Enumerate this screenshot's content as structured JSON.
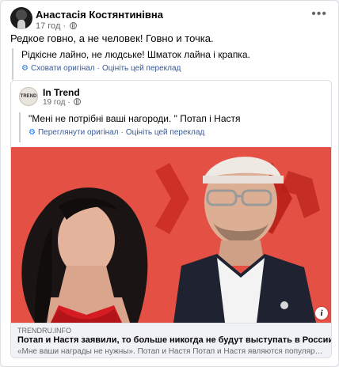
{
  "post": {
    "author": "Анастасія Костянтинівна",
    "time": "17 год",
    "more_icon": "•••",
    "text": "Редкое говно, а не человек! Говно и точка.",
    "translation": {
      "text": "Рідкісне лайно, не людське! Шматок лайна і крапка.",
      "hide_original": "Сховати оригінал",
      "rate": "Оцініть цей переклад"
    }
  },
  "shared": {
    "avatar_text": "TREND",
    "author": "In Trend",
    "time": "19 год",
    "translation": {
      "text": "\"Мені не потрібні ваші нагороди. \" Потап і Настя",
      "view_original": "Переглянути оригінал",
      "rate": "Оцініть цей переклад"
    },
    "link_preview": {
      "domain": "TRENDRU.INFO",
      "title": "Потап и Настя заявили, то больше никогда не будут выступать в России",
      "description": "«Мне ваши награды не нужны». Потап и Настя Потап и Настя являются популярными укр..."
    },
    "info_icon": "i"
  },
  "colors": {
    "link": "#385898",
    "accent": "#1877f2",
    "muted": "#65676b",
    "photo_bg": "#e24a3f"
  }
}
